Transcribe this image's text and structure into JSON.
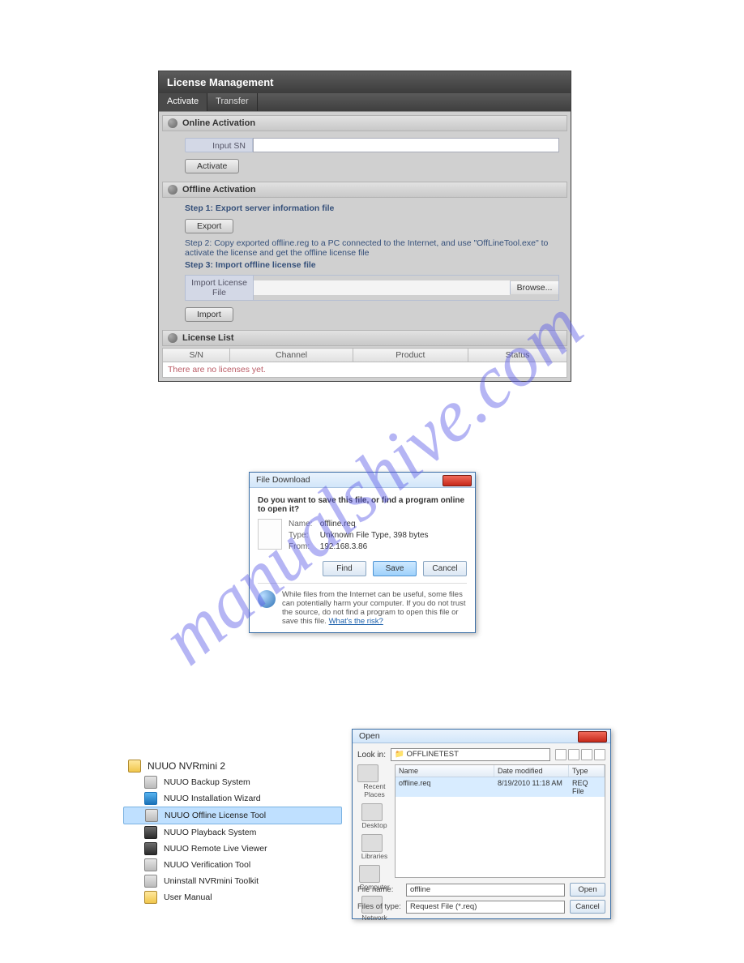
{
  "watermark": "manualshive.com",
  "license": {
    "title": "License Management",
    "tabs": {
      "activate": "Activate",
      "transfer": "Transfer"
    },
    "online": {
      "heading": "Online Activation",
      "sn_label": "Input SN",
      "activate_btn": "Activate"
    },
    "offline": {
      "heading": "Offline Activation",
      "step1": "Step 1: Export server information file",
      "export_btn": "Export",
      "step2": "Step 2: Copy exported offline.reg to a PC connected to the Internet, and use \"OffLineTool.exe\" to activate the license and get the offline license file",
      "step3": "Step 3: Import offline license file",
      "import_label": "Import License File",
      "browse_btn": "Browse...",
      "import_btn": "Import"
    },
    "list": {
      "heading": "License List",
      "cols": {
        "sn": "S/N",
        "channel": "Channel",
        "product": "Product",
        "status": "Status"
      },
      "empty": "There are no licenses yet."
    }
  },
  "download": {
    "title": "File Download",
    "question": "Do you want to save this file, or find a program online to open it?",
    "meta": {
      "name_l": "Name:",
      "name_v": "offline.req",
      "type_l": "Type:",
      "type_v": "Unknown File Type, 398 bytes",
      "from_l": "From:",
      "from_v": "192.168.3.86"
    },
    "buttons": {
      "find": "Find",
      "save": "Save",
      "cancel": "Cancel"
    },
    "warning": "While files from the Internet can be useful, some files can potentially harm your computer. If you do not trust the source, do not find a program to open this file or save this file. ",
    "risk_link": "What's the risk?"
  },
  "menu": {
    "root": "NUUO NVRmini 2",
    "items": [
      "NUUO Backup System",
      "NUUO Installation Wizard",
      "NUUO Offline License Tool",
      "NUUO Playback System",
      "NUUO Remote Live Viewer",
      "NUUO Verification Tool",
      "Uninstall NVRmini Toolkit",
      "User Manual"
    ]
  },
  "open": {
    "title": "Open",
    "lookin_label": "Look in:",
    "lookin_value": "OFFLINETEST",
    "places": [
      "Recent Places",
      "Desktop",
      "Libraries",
      "Computer",
      "Network"
    ],
    "cols": {
      "name": "Name",
      "date": "Date modified",
      "type": "Type"
    },
    "row": {
      "name": "offline.req",
      "date": "8/19/2010 11:18 AM",
      "type": "REQ File"
    },
    "filename_label": "File name:",
    "filename_value": "offline",
    "filter_label": "Files of type:",
    "filter_value": "Request File (*.req)",
    "open_btn": "Open",
    "cancel_btn": "Cancel"
  }
}
